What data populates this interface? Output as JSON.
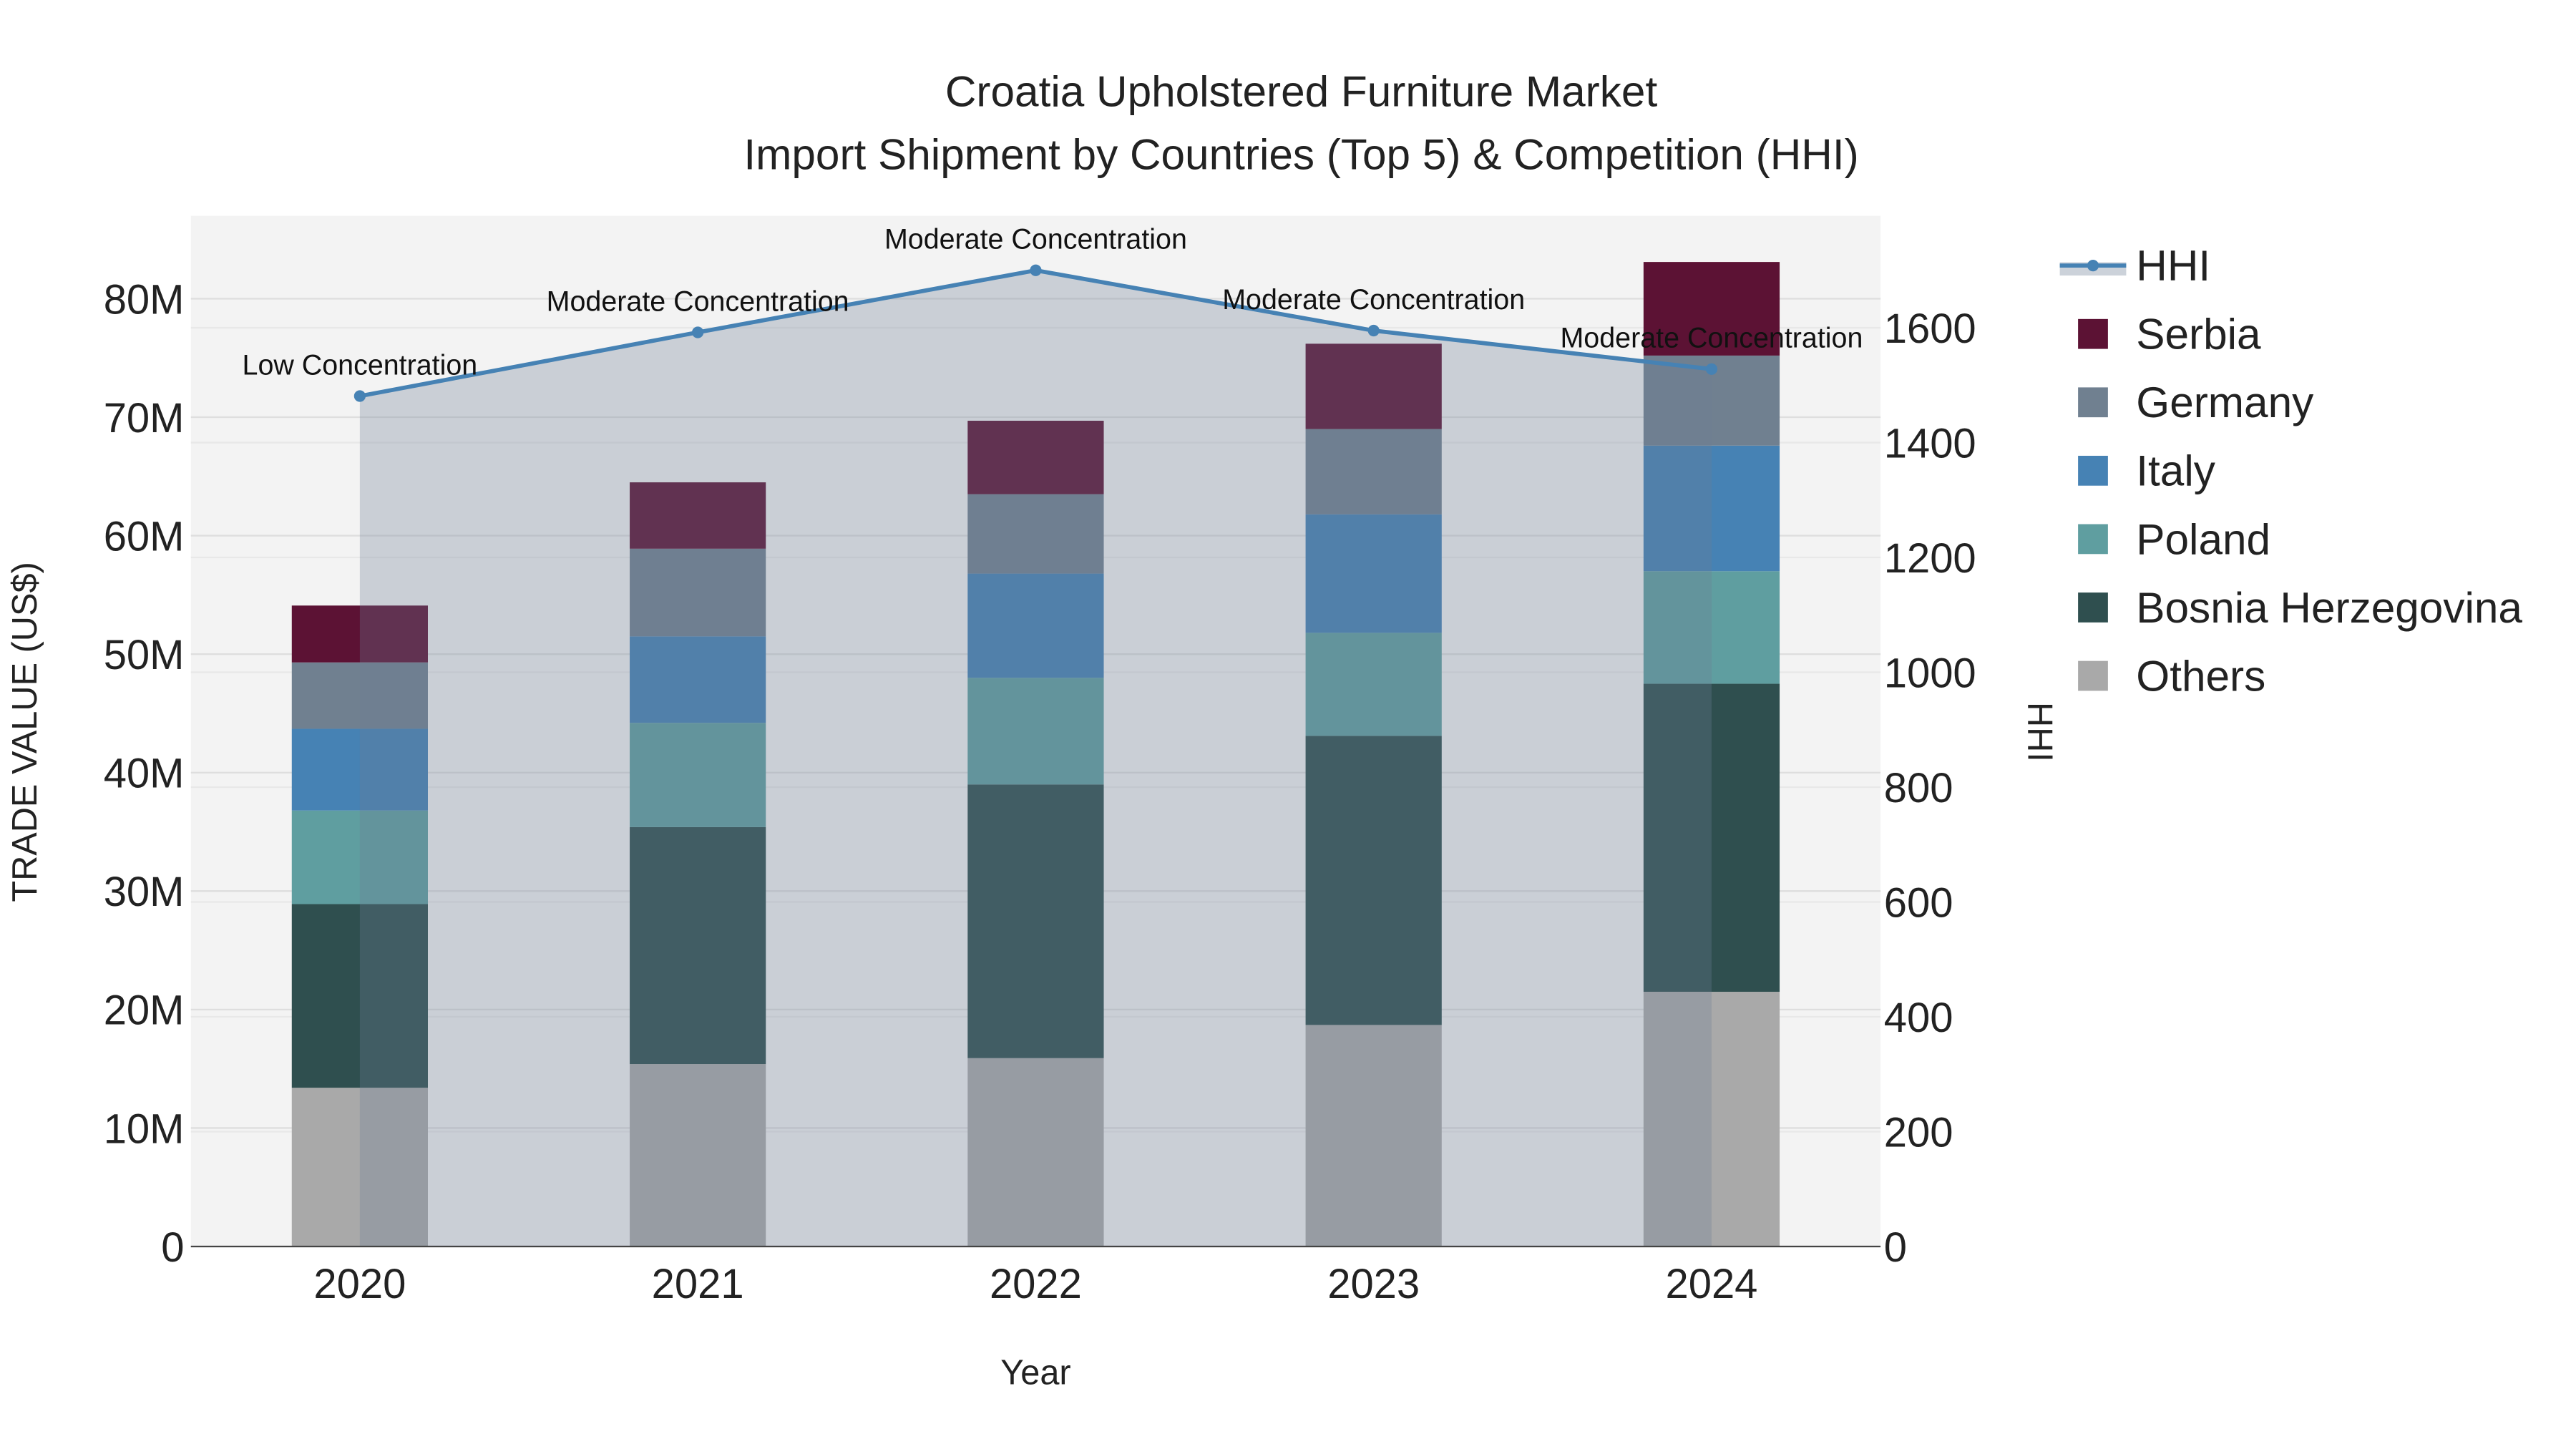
{
  "chart_data": {
    "type": "bar",
    "stacked": true,
    "title": "Croatia Upholstered Furniture Market",
    "subtitle": "Import Shipment by Countries (Top 5) & Competition (HHI)",
    "xlabel": "Year",
    "ylabel": "TRADE VALUE (US$)",
    "y2label": "HHI",
    "categories": [
      "2020",
      "2021",
      "2022",
      "2023",
      "2024"
    ],
    "ylim": [
      0,
      87000000
    ],
    "y_ticks": [
      0,
      10000000,
      20000000,
      30000000,
      40000000,
      50000000,
      60000000,
      70000000,
      80000000
    ],
    "y_tick_labels": [
      "0",
      "10M",
      "20M",
      "30M",
      "40M",
      "50M",
      "60M",
      "70M",
      "80M"
    ],
    "y2lim": [
      0,
      1795
    ],
    "y2_ticks": [
      0,
      200,
      400,
      600,
      800,
      1000,
      1200,
      1400,
      1600
    ],
    "y2_tick_labels": [
      "0",
      "200",
      "400",
      "600",
      "800",
      "1000",
      "1200",
      "1400",
      "1600"
    ],
    "grid": true,
    "legend_position": "right",
    "series": [
      {
        "name": "Others",
        "color": "#a9a9a9",
        "values": [
          13400000,
          15400000,
          15900000,
          18700000,
          21500000
        ]
      },
      {
        "name": "Bosnia Herzegovina",
        "color": "#2f4f4f",
        "values": [
          15500000,
          20000000,
          23100000,
          24400000,
          26000000
        ]
      },
      {
        "name": "Poland",
        "color": "#5f9ea0",
        "values": [
          7900000,
          8800000,
          9000000,
          8700000,
          9500000
        ]
      },
      {
        "name": "Italy",
        "color": "#4682b4",
        "values": [
          6900000,
          7300000,
          8800000,
          10000000,
          10600000
        ]
      },
      {
        "name": "Germany",
        "color": "#708090",
        "values": [
          5600000,
          7400000,
          6700000,
          7200000,
          7600000
        ]
      },
      {
        "name": "Serbia",
        "color": "#5c1234",
        "values": [
          4800000,
          5600000,
          6200000,
          7200000,
          7900000
        ]
      }
    ],
    "line": {
      "name": "HHI",
      "color": "#4682b4",
      "values": [
        1481,
        1592,
        1700,
        1595,
        1528
      ],
      "annotations": [
        "Low Concentration",
        "Moderate Concentration",
        "Moderate Concentration",
        "Moderate Concentration",
        "Moderate Concentration"
      ]
    },
    "legend_order": [
      "HHI",
      "Serbia",
      "Germany",
      "Italy",
      "Poland",
      "Bosnia Herzegovina",
      "Others"
    ]
  }
}
